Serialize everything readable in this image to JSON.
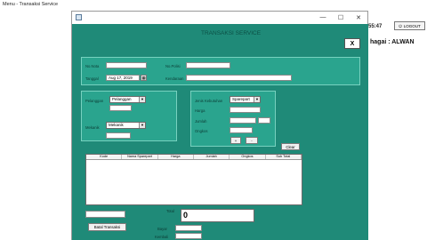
{
  "background": {
    "title": "Menu - Transaksi Service",
    "time": ":55:47",
    "logout_label": "LOGOUT",
    "user_text": "hagai : ALWAN"
  },
  "window": {
    "controls": {
      "minimize": "—",
      "maximize": "☐",
      "close": "✕"
    },
    "header_title": "TRANSAKSI SERVICE",
    "close_label": "X"
  },
  "form": {
    "nomor_label": "No.Nota",
    "tanggal_label": "Tanggal",
    "tanggal_value": "Aug 17, 2019",
    "no_polisi_label": "No.Polisi",
    "kendaraan_label": "Kendaraan",
    "pelanggan_label": "Pelanggan",
    "pelanggan_value": "Pelanggan",
    "mekanik_label": "Mekanik",
    "mekanik_value": "Mekanik",
    "jenis_label": "Jenis Kebutuhan",
    "jenis_value": "Sparepart",
    "harga_label": "Harga",
    "jumlah_label": "Jumlah",
    "ongkos_label": "Ongkos",
    "add_label": "+",
    "minus_label": "-",
    "clear_label": "Clear"
  },
  "table": {
    "headers": [
      "Kode",
      "Nama Sparepart",
      "Harga",
      "Jumlah",
      "Ongkos",
      "Sub Total"
    ]
  },
  "footer": {
    "total_label": "Total",
    "total_value": "0",
    "bayar_label": "Bayar",
    "kembali_label": "Kembali",
    "batal_label": "Batal Transaksi"
  },
  "colors": {
    "panel_bg": "#1f8a78",
    "subpanel_bg": "#2aa48e"
  }
}
